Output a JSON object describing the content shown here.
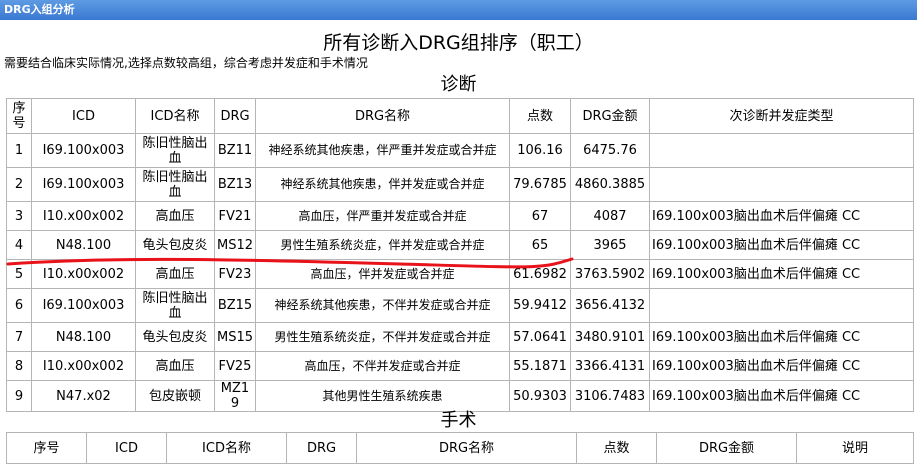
{
  "window": {
    "title": "DRG入组分析"
  },
  "page": {
    "title": "所有诊断入DRG组排序（职工）",
    "note": "需要结合临床实际情况,选择点数较高组，综合考虑并发症和手术情况"
  },
  "diagnosis": {
    "section_title": "诊断",
    "headers": [
      "序号",
      "ICD",
      "ICD名称",
      "DRG",
      "DRG名称",
      "点数",
      "DRG金额",
      "次诊断并发症类型"
    ],
    "rows": [
      {
        "no": "1",
        "icd": "I69.100x003",
        "icd_name": "陈旧性脑出血",
        "drg": "BZ11",
        "drg_name": "神经系统其他疾患，伴严重并发症或合并症",
        "points": "106.16",
        "amount": "6475.76",
        "complication": ""
      },
      {
        "no": "2",
        "icd": "I69.100x003",
        "icd_name": "陈旧性脑出血",
        "drg": "BZ13",
        "drg_name": "神经系统其他疾患，伴并发症或合并症",
        "points": "79.6785",
        "amount": "4860.3885",
        "complication": ""
      },
      {
        "no": "3",
        "icd": "I10.x00x002",
        "icd_name": "高血压",
        "drg": "FV21",
        "drg_name": "高血压，伴严重并发症或合并症",
        "points": "67",
        "amount": "4087",
        "complication": "I69.100x003脑出血术后伴偏瘫 CC"
      },
      {
        "no": "4",
        "icd": "N48.100",
        "icd_name": "龟头包皮炎",
        "drg": "MS12",
        "drg_name": "男性生殖系统炎症，伴并发症或合并症",
        "points": "65",
        "amount": "3965",
        "complication": "I69.100x003脑出血术后伴偏瘫 CC"
      },
      {
        "no": "5",
        "icd": "I10.x00x002",
        "icd_name": "高血压",
        "drg": "FV23",
        "drg_name": "高血压，伴并发症或合并症",
        "points": "61.6982",
        "amount": "3763.5902",
        "complication": "I69.100x003脑出血术后伴偏瘫 CC"
      },
      {
        "no": "6",
        "icd": "I69.100x003",
        "icd_name": "陈旧性脑出血",
        "drg": "BZ15",
        "drg_name": "神经系统其他疾患，不伴并发症或合并症",
        "points": "59.9412",
        "amount": "3656.4132",
        "complication": ""
      },
      {
        "no": "7",
        "icd": "N48.100",
        "icd_name": "龟头包皮炎",
        "drg": "MS15",
        "drg_name": "男性生殖系统炎症，不伴并发症或合并症",
        "points": "57.0641",
        "amount": "3480.9101",
        "complication": "I69.100x003脑出血术后伴偏瘫 CC"
      },
      {
        "no": "8",
        "icd": "I10.x00x002",
        "icd_name": "高血压",
        "drg": "FV25",
        "drg_name": "高血压，不伴并发症或合并症",
        "points": "55.1871",
        "amount": "3366.4131",
        "complication": "I69.100x003脑出血术后伴偏瘫 CC"
      },
      {
        "no": "9",
        "icd": "N47.x02",
        "icd_name": "包皮嵌顿",
        "drg": "MZ19",
        "drg_name": "其他男性生殖系统疾患",
        "points": "50.9303",
        "amount": "3106.7483",
        "complication": "I69.100x003脑出血术后伴偏瘫 CC"
      }
    ]
  },
  "operation": {
    "section_title": "手术",
    "headers": [
      "序号",
      "ICD",
      "ICD名称",
      "DRG",
      "DRG名称",
      "点数",
      "DRG金额",
      "说明"
    ]
  },
  "colors": {
    "titlebar": "#3a78d2",
    "annotation_line": "#e8121a",
    "border": "#b5b5b5"
  }
}
